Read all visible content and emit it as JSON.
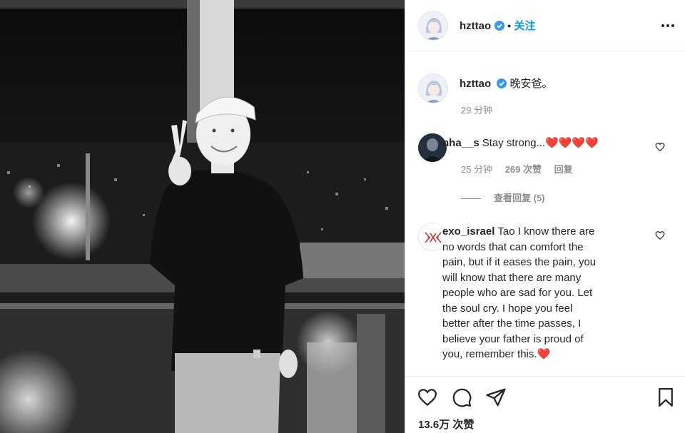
{
  "post": {
    "author": "hzttao",
    "follow_label": "关注",
    "dot": "•",
    "caption": {
      "username": "hzttao",
      "text": "晚安爸。",
      "time": "29 分钟"
    },
    "comments": [
      {
        "username": "nha__s",
        "text": "Stay strong...❤️❤️❤️❤️",
        "time": "25 分钟",
        "likes": "269 次赞",
        "reply": "回复",
        "view_replies": "查看回复 (5)"
      },
      {
        "username": "exo_israel",
        "text_lines": [
          "Tao I know there are",
          "no words that can comfort the",
          "pain, but if it eases the pain, you",
          "will know that there are many",
          "people who are sad for you. Let",
          "the soul cry. I hope you feel",
          "better after the time passes, I",
          "believe your father is proud of",
          "you, remember this.❤️"
        ]
      }
    ],
    "like_count": "13.6万 次赞",
    "icons": {
      "like": "heart-outline-icon",
      "comment": "comment-bubble-icon",
      "share": "paper-plane-icon",
      "save": "bookmark-icon",
      "more": "more-dots-icon"
    },
    "colors": {
      "accent": "#0095f6",
      "verified": "#3897f0",
      "text": "#262626",
      "muted": "#8e8e8e",
      "heart": "#ed4956"
    }
  }
}
